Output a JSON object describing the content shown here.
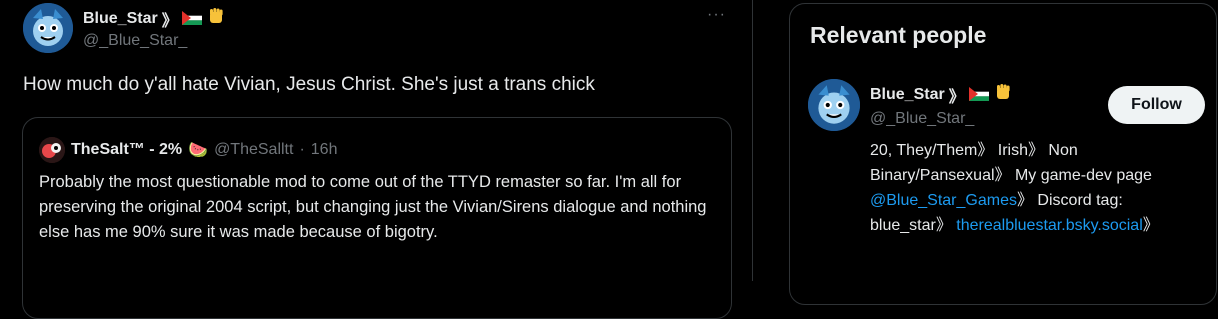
{
  "tweet": {
    "author_name": "Blue_Star",
    "name_suffix": "》",
    "handle": "@_Blue_Star_",
    "more": "···",
    "text": "How much do y'all hate Vivian, Jesus Christ. She's just a trans chick"
  },
  "quote": {
    "author_name": "TheSalt™ - 2%",
    "watermelon": "🍉",
    "handle": "@TheSalltt",
    "sep": "·",
    "time": "16h",
    "body": "Probably the most questionable mod to come out of the TTYD remaster so far. I'm all for preserving the original 2004 script, but changing just the Vivian/Sirens dialogue and nothing else has me 90% sure it was made because of bigotry."
  },
  "panel": {
    "title": "Relevant people",
    "name": "Blue_Star",
    "name_suffix": "》",
    "handle": "@_Blue_Star_",
    "follow_label": "Follow",
    "bio_part1": "20, They/Them》 Irish》 Non Binary/Pansexual》 My game-dev page ",
    "bio_link1": "@Blue_Star_Games",
    "bio_part2": "》 Discord tag: blue_star》 ",
    "bio_link2": "therealbluestar.bsky.social",
    "bio_part3": "》"
  },
  "colors": {
    "link": "#1d9bf0",
    "muted": "#71767b",
    "border": "#2f3336"
  },
  "icons": [
    "palestine-flag-icon",
    "raised-fist-icon",
    "more-icon",
    "watermelon-icon"
  ]
}
